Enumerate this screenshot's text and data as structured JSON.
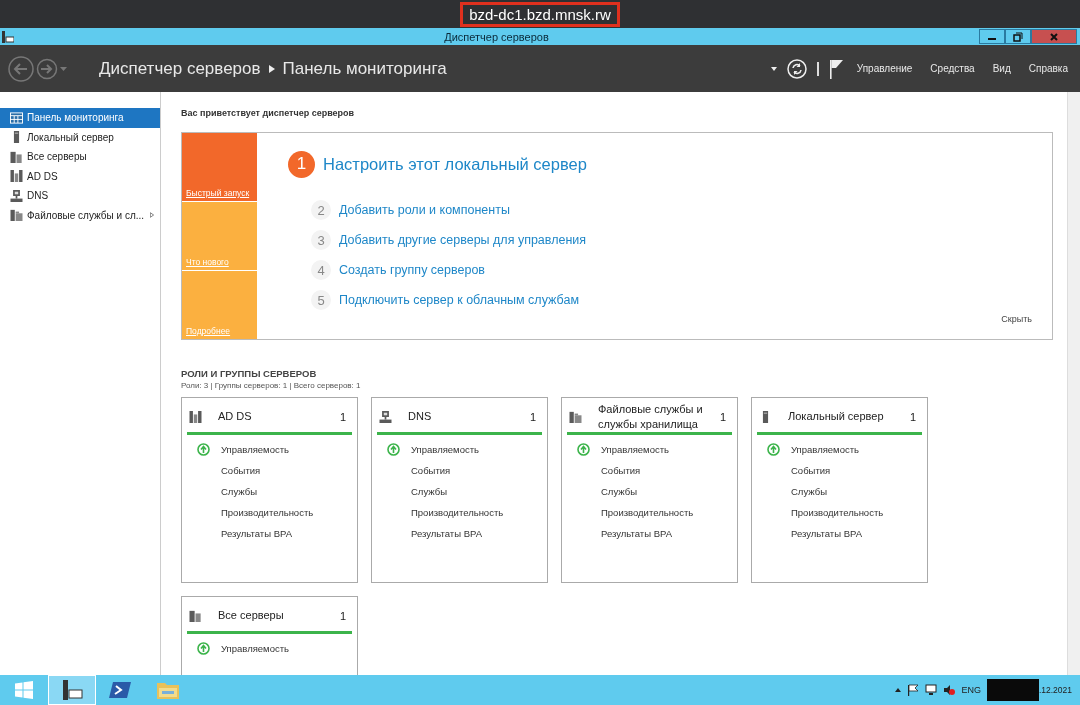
{
  "remote_title": "bzd-dc1.bzd.mnsk.rw",
  "window": {
    "title": "Диспетчер серверов"
  },
  "header": {
    "breadcrumb": [
      "Диспетчер серверов",
      "Панель мониторинга"
    ],
    "menu": [
      "Управление",
      "Средства",
      "Вид",
      "Справка"
    ]
  },
  "sidebar": {
    "items": [
      {
        "label": "Панель мониторинга",
        "kind": "dashboard",
        "selected": true,
        "expandable": false
      },
      {
        "label": "Локальный сервер",
        "kind": "server",
        "selected": false,
        "expandable": false
      },
      {
        "label": "Все серверы",
        "kind": "servers",
        "selected": false,
        "expandable": false
      },
      {
        "label": "AD DS",
        "kind": "adds",
        "selected": false,
        "expandable": false
      },
      {
        "label": "DNS",
        "kind": "dns",
        "selected": false,
        "expandable": false
      },
      {
        "label": "Файловые службы и сл...",
        "kind": "files",
        "selected": false,
        "expandable": true
      }
    ]
  },
  "welcome": {
    "title": "Вас приветствует диспетчер серверов",
    "quick_tiles": [
      {
        "label": "Быстрый запуск",
        "selected": true
      },
      {
        "label": "Что нового",
        "selected": false
      },
      {
        "label": "Подробнее",
        "selected": false
      }
    ],
    "steps": [
      {
        "number": "1",
        "label": "Настроить этот локальный сервер",
        "kind": "primary"
      },
      {
        "number": "2",
        "label": "Добавить роли и компоненты",
        "kind": "secondary"
      },
      {
        "number": "3",
        "label": "Добавить другие серверы для управления",
        "kind": "secondary"
      },
      {
        "number": "4",
        "label": "Создать группу серверов",
        "kind": "secondary"
      },
      {
        "number": "5",
        "label": "Подключить сервер к облачным службам",
        "kind": "secondary"
      }
    ],
    "hide": "Скрыть"
  },
  "roles": {
    "title": "РОЛИ И ГРУППЫ СЕРВЕРОВ",
    "summary": "Роли: 3 | Группы серверов: 1 | Всего серверов: 1",
    "tiles": [
      {
        "title": "AD DS",
        "kind": "adds",
        "count": "1",
        "items": [
          {
            "label": "Управляемость",
            "ok": true
          },
          {
            "label": "События",
            "ok": false
          },
          {
            "label": "Службы",
            "ok": false
          },
          {
            "label": "Производительность",
            "ok": false
          },
          {
            "label": "Результаты BPA",
            "ok": false
          }
        ]
      },
      {
        "title": "DNS",
        "kind": "dns",
        "count": "1",
        "items": [
          {
            "label": "Управляемость",
            "ok": true
          },
          {
            "label": "События",
            "ok": false
          },
          {
            "label": "Службы",
            "ok": false
          },
          {
            "label": "Производительность",
            "ok": false
          },
          {
            "label": "Результаты BPA",
            "ok": false
          }
        ]
      },
      {
        "title": "Файловые службы и службы хранилища",
        "kind": "files",
        "count": "1",
        "items": [
          {
            "label": "Управляемость",
            "ok": true
          },
          {
            "label": "События",
            "ok": false
          },
          {
            "label": "Службы",
            "ok": false
          },
          {
            "label": "Производительность",
            "ok": false
          },
          {
            "label": "Результаты BPA",
            "ok": false
          }
        ]
      },
      {
        "title": "Локальный сервер",
        "kind": "server",
        "count": "1",
        "items": [
          {
            "label": "Управляемость",
            "ok": true
          },
          {
            "label": "События",
            "ok": false
          },
          {
            "label": "Службы",
            "ok": false
          },
          {
            "label": "Производительность",
            "ok": false
          },
          {
            "label": "Результаты BPA",
            "ok": false
          }
        ]
      },
      {
        "title": "Все серверы",
        "kind": "servers",
        "count": "1",
        "items": [
          {
            "label": "Управляемость",
            "ok": true
          }
        ]
      }
    ]
  },
  "taskbar": {
    "language": "ENG",
    "date": ".12.2021"
  }
}
